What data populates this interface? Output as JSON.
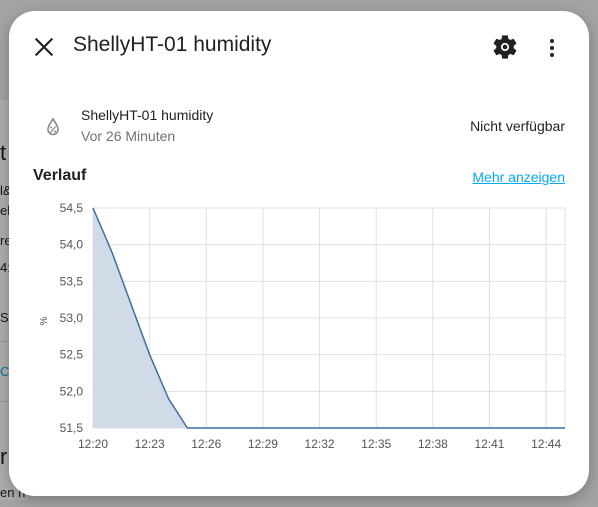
{
  "dialog": {
    "title": "ShellyHT-01 humidity",
    "close_icon": "close-icon",
    "settings_icon": "gear-icon",
    "menu_icon": "more-vertical-icon"
  },
  "entity": {
    "icon": "water-percent-off-icon",
    "name": "ShellyHT-01 humidity",
    "last_changed": "Vor 26 Minuten",
    "state": "Nicht verfügbar"
  },
  "history": {
    "title": "Verlauf",
    "more_link": "Mehr anzeigen"
  },
  "background": {
    "peek_texts": [
      "t",
      "l&",
      "ell",
      "re",
      "4:",
      "S",
      "CH",
      "r",
      "en n"
    ]
  },
  "colors": {
    "accent": "#03a9f4",
    "series_line": "#3b6fa3",
    "series_fill": "#cfd9e6"
  },
  "chart_data": {
    "type": "area",
    "x": [
      "12:20",
      "12:21",
      "12:22",
      "12:23",
      "12:24",
      "12:25",
      "12:26",
      "12:27",
      "12:28",
      "12:29",
      "12:30",
      "12:31",
      "12:32",
      "12:33",
      "12:34",
      "12:35",
      "12:36",
      "12:37",
      "12:38",
      "12:39",
      "12:40",
      "12:41",
      "12:42",
      "12:43",
      "12:44",
      "12:45"
    ],
    "y": [
      54.5,
      53.9,
      53.2,
      52.5,
      51.9,
      51.5,
      51.5,
      51.5,
      51.5,
      51.5,
      51.5,
      51.5,
      51.5,
      51.5,
      51.5,
      51.5,
      51.5,
      51.5,
      51.5,
      51.5,
      51.5,
      51.5,
      51.5,
      51.5,
      51.5,
      51.5
    ],
    "x_ticks": [
      "12:20",
      "12:23",
      "12:26",
      "12:29",
      "12:32",
      "12:35",
      "12:38",
      "12:41",
      "12:44"
    ],
    "y_ticks": [
      "54,5",
      "54,0",
      "53,5",
      "53,0",
      "52,5",
      "52,0",
      "51,5"
    ],
    "ylim": [
      51.5,
      54.5
    ],
    "ylabel": "%",
    "grid": true
  }
}
